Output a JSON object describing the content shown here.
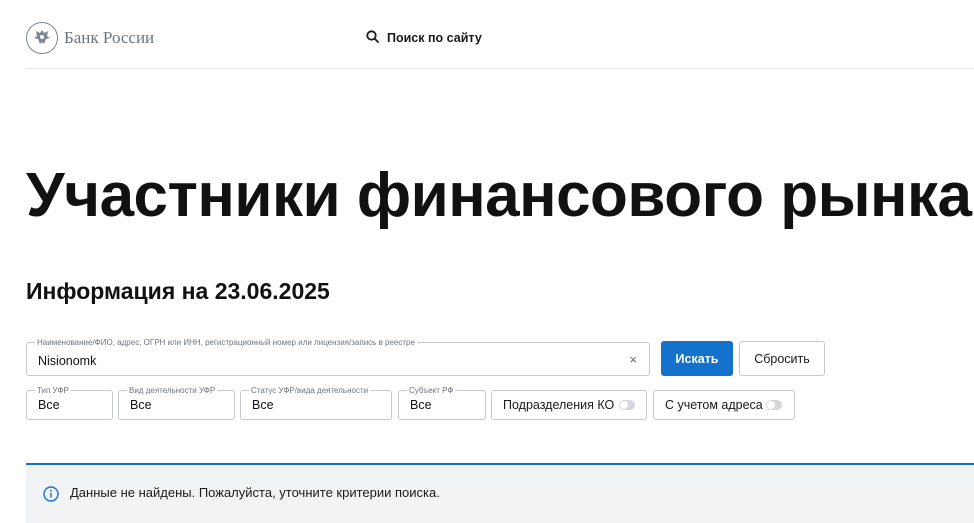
{
  "header": {
    "logo_text": "Банк России",
    "search_label": "Поиск по сайту"
  },
  "page": {
    "title": "Участники финансового рынка",
    "info_date": "Информация на 23.06.2025"
  },
  "search": {
    "label": "Наименование/ФИО, адрес, ОГРН или ИНН, регистрационный номер или лицензия/запись в реестре",
    "value": "Nisionomk",
    "clear_symbol": "×",
    "submit_label": "Искать",
    "reset_label": "Сбросить"
  },
  "filters": [
    {
      "label": "Тип УФР",
      "value": "Все"
    },
    {
      "label": "Вид деятельности УФР",
      "value": "Все"
    },
    {
      "label": "Статус УФР/вида деятельности",
      "value": "Все"
    },
    {
      "label": "Субъект РФ",
      "value": "Все"
    }
  ],
  "toggles": [
    {
      "label": "Подразделения КО",
      "on": false
    },
    {
      "label": "С учетом адреса",
      "on": false
    }
  ],
  "notice": {
    "text": "Данные не найдены. Пожалуйста, уточните критерии поиска.",
    "icon": "info-icon"
  },
  "colors": {
    "accent": "#1572cc",
    "notice_bg": "#f2f3f4",
    "border": "#c6cad0"
  }
}
